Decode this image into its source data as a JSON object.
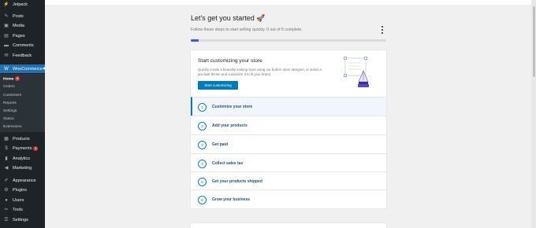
{
  "sidebar": {
    "top_items": [
      {
        "label": "Jetpack",
        "icon": "jetpack-icon",
        "glyph": "⚡"
      },
      {
        "label": "Posts",
        "icon": "pin-icon",
        "glyph": "✎"
      },
      {
        "label": "Media",
        "icon": "media-icon",
        "glyph": "▣"
      },
      {
        "label": "Pages",
        "icon": "page-icon",
        "glyph": "▤"
      },
      {
        "label": "Comments",
        "icon": "comment-icon",
        "glyph": "▬"
      },
      {
        "label": "Feedback",
        "icon": "feedback-icon",
        "glyph": "✉"
      }
    ],
    "woocommerce": {
      "label": "WooCommerce",
      "icon": "woocommerce-icon",
      "glyph": "W"
    },
    "submenu": [
      {
        "label": "Home",
        "badge": "6"
      },
      {
        "label": "Orders"
      },
      {
        "label": "Customers"
      },
      {
        "label": "Reports"
      },
      {
        "label": "Settings"
      },
      {
        "label": "Status"
      },
      {
        "label": "Extensions"
      }
    ],
    "bottom_items": [
      {
        "label": "Products",
        "icon": "box-icon",
        "glyph": "▦"
      },
      {
        "label": "Payments",
        "icon": "payments-icon",
        "glyph": "$",
        "badge": "1"
      },
      {
        "label": "Analytics",
        "icon": "analytics-icon",
        "glyph": "▮"
      },
      {
        "label": "Marketing",
        "icon": "megaphone-icon",
        "glyph": "◀"
      },
      {
        "label": "Appearance",
        "icon": "brush-icon",
        "glyph": "✐"
      },
      {
        "label": "Plugins",
        "icon": "plugin-icon",
        "glyph": "⚙"
      },
      {
        "label": "Users",
        "icon": "user-icon",
        "glyph": "●"
      },
      {
        "label": "Tools",
        "icon": "wrench-icon",
        "glyph": "✂"
      },
      {
        "label": "Settings",
        "icon": "settings-icon",
        "glyph": "☰"
      }
    ]
  },
  "main": {
    "title": "Let's get you started 🚀",
    "subtitle": "Follow these steps to start selling quickly. 0 out of 6 complete.",
    "progress_fraction": 0.04,
    "accent": "#3858e9",
    "hero": {
      "title": "Start customizing your store",
      "description": "Quickly create a beautiful looking store using our built-in store designer, or select a pre-built theme and customize it to fit your brand.",
      "button": "Start customizing"
    },
    "tasks": [
      {
        "num": "1",
        "label": "Customize your store",
        "active": true
      },
      {
        "num": "2",
        "label": "Add your products"
      },
      {
        "num": "3",
        "label": "Get paid"
      },
      {
        "num": "4",
        "label": "Collect sales tax"
      },
      {
        "num": "5",
        "label": "Get your products shipped"
      },
      {
        "num": "6",
        "label": "Grow your business"
      }
    ]
  }
}
